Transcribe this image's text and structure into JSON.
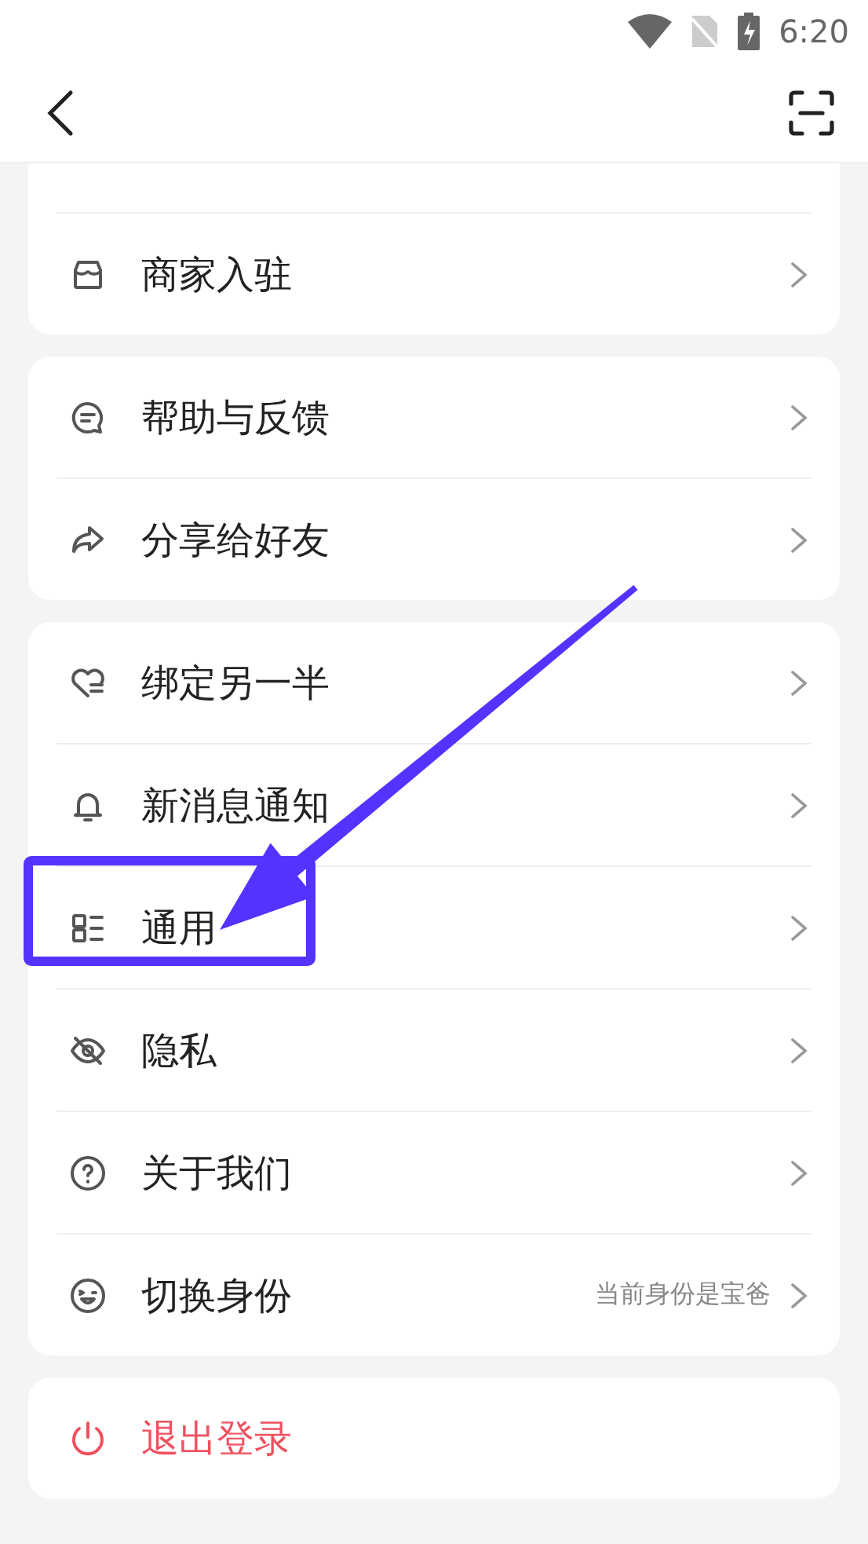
{
  "status_bar": {
    "time": "6:20"
  },
  "groups": [
    {
      "cut_top": true,
      "items": [
        {
          "label": "商家入驻"
        }
      ]
    },
    {
      "items": [
        {
          "label": "帮助与反馈"
        },
        {
          "label": "分享给好友"
        }
      ]
    },
    {
      "items": [
        {
          "label": "绑定另一半"
        },
        {
          "label": "新消息通知"
        },
        {
          "label": "通用"
        },
        {
          "label": "隐私"
        },
        {
          "label": "关于我们"
        },
        {
          "label": "切换身份",
          "value": "当前身份是宝爸"
        }
      ]
    }
  ],
  "logout": {
    "label": "退出登录"
  }
}
